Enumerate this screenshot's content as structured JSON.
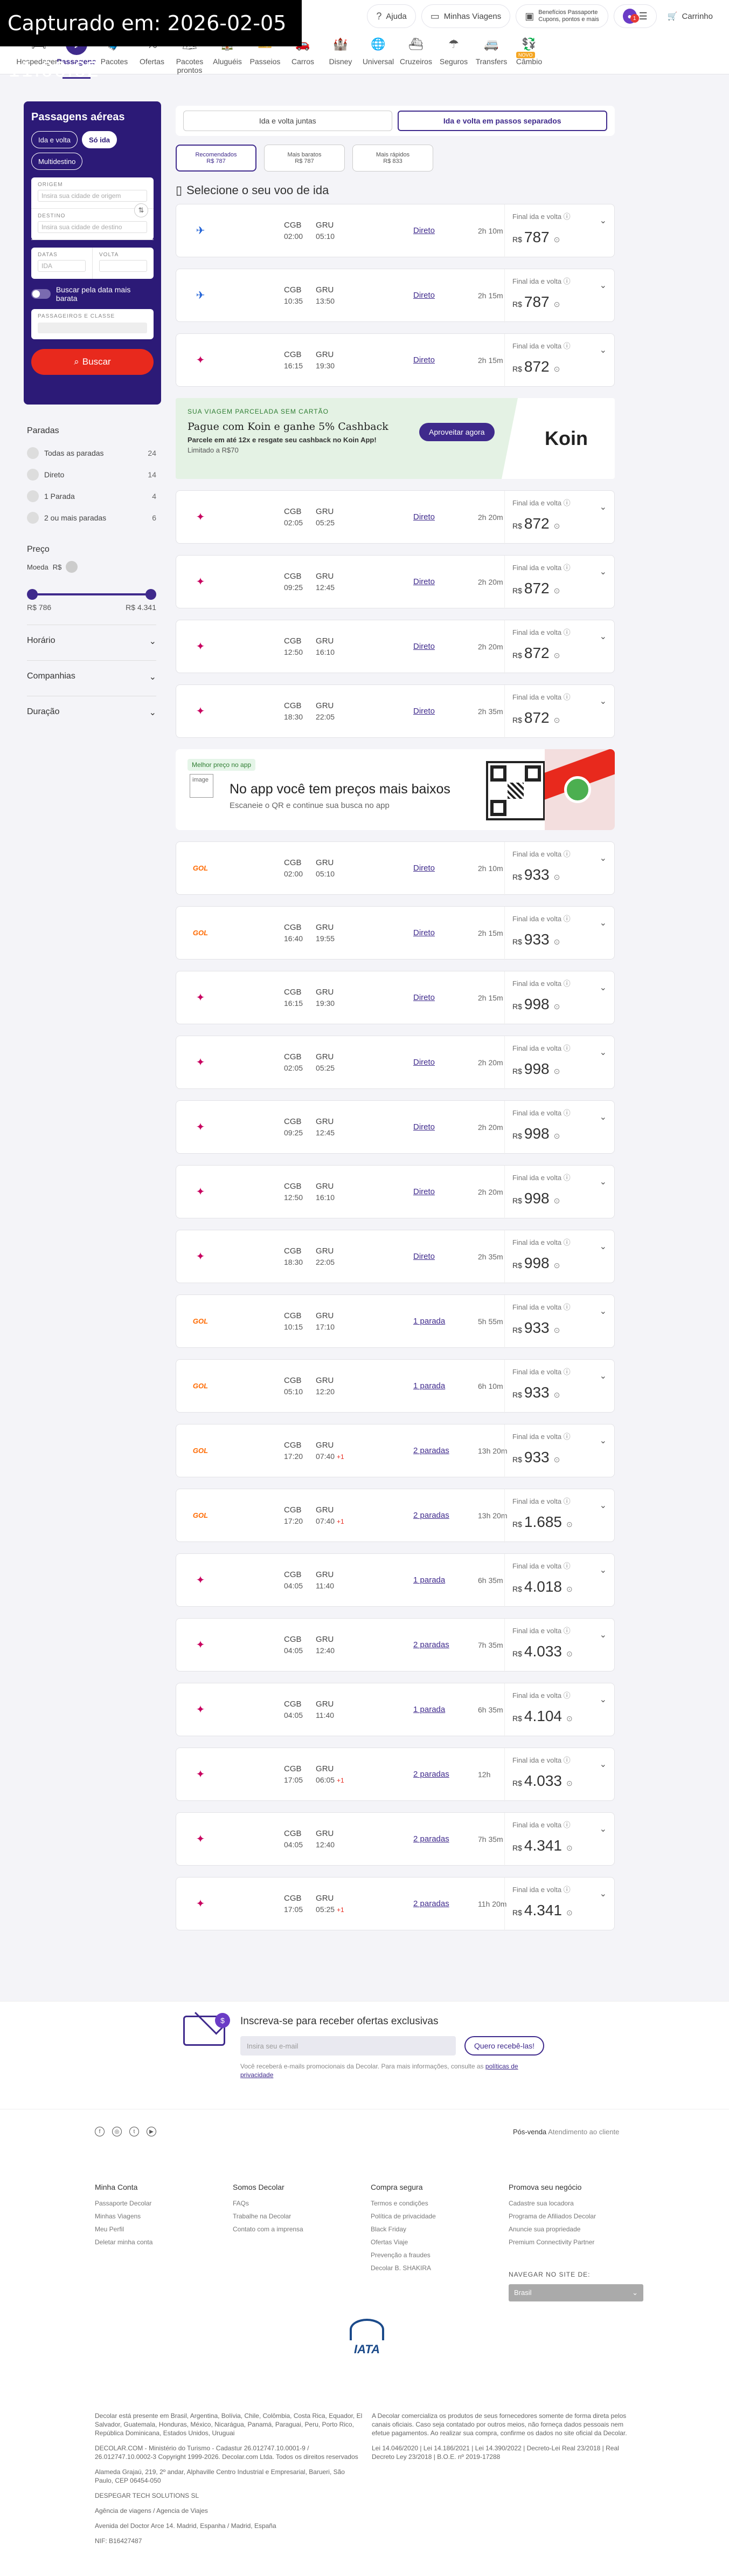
{
  "capture_label": "Capturado em: 2026-02-05 11:00:02",
  "header": {
    "help": "Ajuda",
    "trips": "Minhas Viagens",
    "benefits": [
      "Benefícios Passaporte",
      "Cupons, pontos e mais"
    ],
    "account_icon": "user-icon",
    "notifications": "1",
    "cart": "Carrinho"
  },
  "nav": [
    {
      "label": "Hospedagem",
      "icon": "🛏"
    },
    {
      "label": "Passagens",
      "icon": "✈"
    },
    {
      "label": "Pacotes",
      "icon": "🧳"
    },
    {
      "label": "Ofertas",
      "icon": "%"
    },
    {
      "label": "Pacotes prontos",
      "icon": "🗺"
    },
    {
      "label": "Aluguéis",
      "icon": "🏠"
    },
    {
      "label": "Passeios",
      "icon": "🎫"
    },
    {
      "label": "Carros",
      "icon": "🚗"
    },
    {
      "label": "Disney",
      "icon": "🏰"
    },
    {
      "label": "Universal",
      "icon": "🌐"
    },
    {
      "label": "Cruzeiros",
      "icon": "⛴"
    },
    {
      "label": "Seguros",
      "icon": "☂"
    },
    {
      "label": "Transfers",
      "icon": "🚐"
    },
    {
      "label": "Câmbio",
      "icon": "💱",
      "badge": "NOVO"
    }
  ],
  "search": {
    "title": "Passagens aéreas",
    "trip_types": [
      "Ida e volta",
      "Só ida",
      "Multidestino"
    ],
    "origin_label": "ORIGEM",
    "origin_placeholder": "Insira sua cidade de origem",
    "dest_label": "DESTINO",
    "dest_placeholder": "Insira sua cidade de destino",
    "dates_label": "DATAS",
    "ida_label": "IDA",
    "volta_label": "VOLTA",
    "flex_label": "Buscar pela data mais barata",
    "pax_label": "PASSAGEIROS E CLASSE",
    "button": "Buscar"
  },
  "filters": {
    "stops_title": "Paradas",
    "stops": [
      {
        "label": "Todas as paradas",
        "count": "24"
      },
      {
        "label": "Direto",
        "count": "14"
      },
      {
        "label": "1 Parada",
        "count": "4"
      },
      {
        "label": "2 ou mais paradas",
        "count": "6"
      }
    ],
    "price_title": "Preço",
    "currency_label": "Moeda",
    "currency": "R$",
    "min": "R$ 786",
    "max": "R$ 4.341",
    "sections": [
      "Horário",
      "Companhias",
      "Duração"
    ]
  },
  "tabs": [
    "Ida e volta juntas",
    "Ida e volta em passos separados"
  ],
  "sorts": [
    {
      "label": "Recomendados",
      "price": "R$ 787"
    },
    {
      "label": "Mais baratos",
      "price": "R$ 787"
    },
    {
      "label": "Mais rápidos",
      "price": "R$ 833"
    }
  ],
  "select_title": "Selecione o seu voo de ida",
  "fare_label": "Final ida e volta",
  "flights_a": [
    {
      "airline": "azul",
      "from": "CGB",
      "dep": "02:00",
      "to": "GRU",
      "arr": "05:10",
      "plus": "",
      "stops": "Direto",
      "dur": "2h 10m",
      "price": "787"
    },
    {
      "airline": "azul",
      "from": "CGB",
      "dep": "10:35",
      "to": "GRU",
      "arr": "13:50",
      "plus": "",
      "stops": "Direto",
      "dur": "2h 15m",
      "price": "787"
    },
    {
      "airline": "latam",
      "from": "CGB",
      "dep": "16:15",
      "to": "GRU",
      "arr": "19:30",
      "plus": "",
      "stops": "Direto",
      "dur": "2h 15m",
      "price": "872"
    }
  ],
  "koin": {
    "tag": "SUA VIAGEM PARCELADA SEM CARTÃO",
    "headline": "Pague com Koin e ganhe 5% Cashback",
    "sub": "Parcele em até 12x e resgate seu cashback no Koin App!",
    "limit": "Limitado a R$70",
    "button": "Aproveitar agora",
    "brand": "Koin"
  },
  "flights_b": [
    {
      "airline": "latam",
      "from": "CGB",
      "dep": "02:05",
      "to": "GRU",
      "arr": "05:25",
      "plus": "",
      "stops": "Direto",
      "dur": "2h 20m",
      "price": "872"
    },
    {
      "airline": "latam",
      "from": "CGB",
      "dep": "09:25",
      "to": "GRU",
      "arr": "12:45",
      "plus": "",
      "stops": "Direto",
      "dur": "2h 20m",
      "price": "872"
    },
    {
      "airline": "latam",
      "from": "CGB",
      "dep": "12:50",
      "to": "GRU",
      "arr": "16:10",
      "plus": "",
      "stops": "Direto",
      "dur": "2h 20m",
      "price": "872"
    },
    {
      "airline": "latam",
      "from": "CGB",
      "dep": "18:30",
      "to": "GRU",
      "arr": "22:05",
      "plus": "",
      "stops": "Direto",
      "dur": "2h 35m",
      "price": "872"
    }
  ],
  "app": {
    "badge": "Melhor preço no app",
    "img_alt": "image",
    "headline": "No app você tem preços mais baixos",
    "sub": "Escaneie o QR e continue sua busca no app"
  },
  "flights_c": [
    {
      "airline": "gol",
      "from": "CGB",
      "dep": "02:00",
      "to": "GRU",
      "arr": "05:10",
      "plus": "",
      "stops": "Direto",
      "dur": "2h 10m",
      "price": "933"
    },
    {
      "airline": "gol",
      "from": "CGB",
      "dep": "16:40",
      "to": "GRU",
      "arr": "19:55",
      "plus": "",
      "stops": "Direto",
      "dur": "2h 15m",
      "price": "933"
    },
    {
      "airline": "latam",
      "from": "CGB",
      "dep": "16:15",
      "to": "GRU",
      "arr": "19:30",
      "plus": "",
      "stops": "Direto",
      "dur": "2h 15m",
      "price": "998"
    },
    {
      "airline": "latam",
      "from": "CGB",
      "dep": "02:05",
      "to": "GRU",
      "arr": "05:25",
      "plus": "",
      "stops": "Direto",
      "dur": "2h 20m",
      "price": "998"
    },
    {
      "airline": "latam",
      "from": "CGB",
      "dep": "09:25",
      "to": "GRU",
      "arr": "12:45",
      "plus": "",
      "stops": "Direto",
      "dur": "2h 20m",
      "price": "998"
    },
    {
      "airline": "latam",
      "from": "CGB",
      "dep": "12:50",
      "to": "GRU",
      "arr": "16:10",
      "plus": "",
      "stops": "Direto",
      "dur": "2h 20m",
      "price": "998"
    },
    {
      "airline": "latam",
      "from": "CGB",
      "dep": "18:30",
      "to": "GRU",
      "arr": "22:05",
      "plus": "",
      "stops": "Direto",
      "dur": "2h 35m",
      "price": "998"
    },
    {
      "airline": "gol",
      "from": "CGB",
      "dep": "10:15",
      "to": "GRU",
      "arr": "17:10",
      "plus": "",
      "stops": "1 parada",
      "dur": "5h 55m",
      "price": "933"
    },
    {
      "airline": "gol",
      "from": "CGB",
      "dep": "05:10",
      "to": "GRU",
      "arr": "12:20",
      "plus": "",
      "stops": "1 parada",
      "dur": "6h 10m",
      "price": "933"
    },
    {
      "airline": "gol",
      "from": "CGB",
      "dep": "17:20",
      "to": "GRU",
      "arr": "07:40",
      "plus": "+1",
      "stops": "2 paradas",
      "dur": "13h 20m",
      "price": "933"
    },
    {
      "airline": "gol",
      "from": "CGB",
      "dep": "17:20",
      "to": "GRU",
      "arr": "07:40",
      "plus": "+1",
      "stops": "2 paradas",
      "dur": "13h 20m",
      "price": "1.685"
    },
    {
      "airline": "latam",
      "from": "CGB",
      "dep": "04:05",
      "to": "GRU",
      "arr": "11:40",
      "plus": "",
      "stops": "1 parada",
      "dur": "6h 35m",
      "price": "4.018"
    },
    {
      "airline": "latam",
      "from": "CGB",
      "dep": "04:05",
      "to": "GRU",
      "arr": "12:40",
      "plus": "",
      "stops": "2 paradas",
      "dur": "7h 35m",
      "price": "4.033"
    },
    {
      "airline": "latam",
      "from": "CGB",
      "dep": "04:05",
      "to": "GRU",
      "arr": "11:40",
      "plus": "",
      "stops": "1 parada",
      "dur": "6h 35m",
      "price": "4.104"
    },
    {
      "airline": "latam",
      "from": "CGB",
      "dep": "17:05",
      "to": "GRU",
      "arr": "06:05",
      "plus": "+1",
      "stops": "2 paradas",
      "dur": "12h",
      "price": "4.033"
    },
    {
      "airline": "latam",
      "from": "CGB",
      "dep": "04:05",
      "to": "GRU",
      "arr": "12:40",
      "plus": "",
      "stops": "2 paradas",
      "dur": "7h 35m",
      "price": "4.341"
    },
    {
      "airline": "latam",
      "from": "CGB",
      "dep": "17:05",
      "to": "GRU",
      "arr": "05:25",
      "plus": "+1",
      "stops": "2 paradas",
      "dur": "11h 20m",
      "price": "4.341"
    }
  ],
  "newsletter": {
    "title": "Inscreva-se para receber ofertas exclusivas",
    "placeholder": "Insira seu e-mail",
    "button": "Quero recebê-las!",
    "note": "Você receberá e-mails promocionais da Decolar. Para mais informações, consulte as",
    "link": "políticas de privacidade"
  },
  "footer": {
    "posvenda": "Pós-venda",
    "atendimento": "Atendimento ao cliente",
    "cols": [
      {
        "title": "Minha Conta",
        "items": [
          "Passaporte Decolar",
          "Minhas Viagens",
          "Meu Perfil",
          "Deletar minha conta"
        ]
      },
      {
        "title": "Somos Decolar",
        "items": [
          "FAQs",
          "Trabalhe na Decolar",
          "Contato com a imprensa"
        ]
      },
      {
        "title": "Compra segura",
        "items": [
          "Termos e condições",
          "Política de privacidade",
          "Black Friday",
          "Ofertas Viaje",
          "Prevenção a fraudes",
          "Decolar B. SHAKIRA"
        ]
      },
      {
        "title": "Promova seu negócio",
        "items": [
          "Cadastre sua locadora",
          "Programa de Afiliados Decolar",
          "Anuncie sua propriedade",
          "Premium Connectivity Partner"
        ]
      }
    ],
    "nav_site_label": "NAVEGAR NO SITE DE:",
    "nav_site_value": "Brasil",
    "iata": "IATA",
    "legal_left": [
      "Decolar está presente em Brasil, Argentina, Bolívia, Chile, Colômbia, Costa Rica, Equador, El Salvador, Guatemala, Honduras, México, Nicarágua, Panamá, Paraguai, Peru, Porto Rico, República Dominicana, Estados Unidos, Uruguai",
      "DECOLAR.COM - Ministério do Turismo - Cadastur 26.012747.10.0001-9 / 26.012747.10.0002-3 Copyright 1999-2026. Decolar.com Ltda. Todos os direitos reservados",
      "Alameda Grajaú, 219, 2º andar, Alphaville Centro Industrial e Empresarial, Barueri, São Paulo, CEP 06454-050",
      "DESPEGAR TECH SOLUTIONS SL",
      "Agência de viagens / Agencia de Viajes",
      "Avenida del Doctor Arce 14. Madrid, Espanha / Madrid, España",
      "NIF: B16427487"
    ],
    "legal_right": [
      "A Decolar comercializa os produtos de seus fornecedores somente de forma direta pelos canais oficiais. Caso seja contatado por outros meios, não forneça dados pessoais nem efetue pagamentos. Ao realizar sua compra, confirme os dados no site oficial da Decolar.",
      "Lei 14.046/2020 | Lei 14.186/2021 | Lei 14.390/2022 | Decreto-Lei Real 23/2018 | Real Decreto Ley 23/2018 | B.O.E. nº 2019-17288"
    ]
  }
}
